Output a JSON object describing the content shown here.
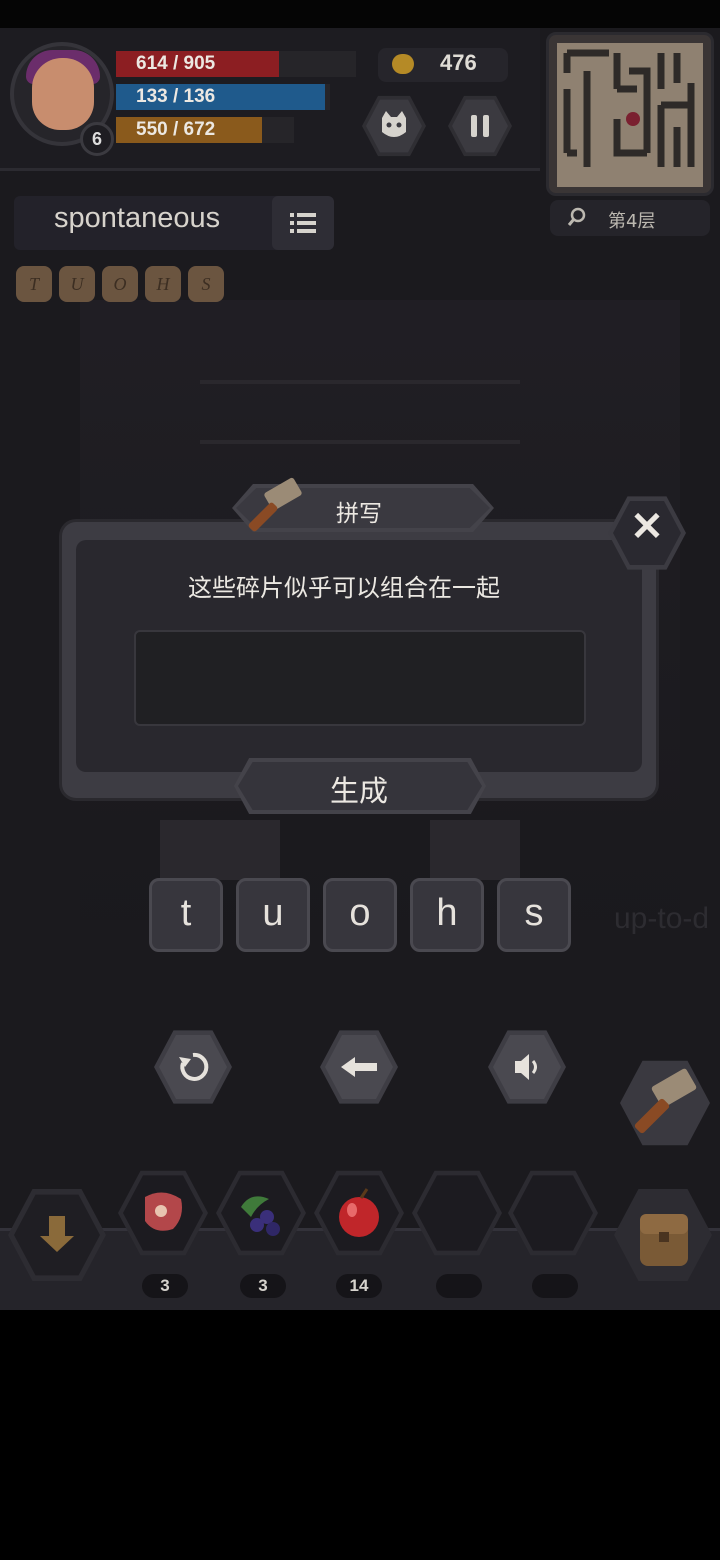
{
  "player": {
    "level": "6",
    "hp_text": "614 / 905",
    "hp_fraction": 0.678,
    "mp_text": "133 / 136",
    "mp_fraction": 0.978,
    "xp_text": "550 / 672",
    "xp_fraction": 0.818,
    "hp_color": "#8c1e22",
    "mp_color": "#1f5a8c",
    "xp_color": "#8a5a1c"
  },
  "gold": "476",
  "floor": "第4层",
  "current_word": "spontaneous",
  "fragments": [
    "T",
    "U",
    "O",
    "H",
    "S"
  ],
  "dialog": {
    "title": "拼写",
    "message": "这些碎片似乎可以组合在一起",
    "input_value": "",
    "generate_label": "生成"
  },
  "letter_tiles": [
    "t",
    "u",
    "o",
    "h",
    "s"
  ],
  "background_hint": "up-to-d",
  "items": [
    {
      "icon": "meat-icon",
      "count": "3"
    },
    {
      "icon": "berries-icon",
      "count": "3"
    },
    {
      "icon": "apple-icon",
      "count": "14"
    },
    {
      "icon": "empty-slot",
      "count": ""
    },
    {
      "icon": "empty-slot",
      "count": ""
    }
  ],
  "icons": {
    "pet": "cat-face-icon",
    "pause": "pause-icon",
    "search": "search-icon",
    "list": "list-icon",
    "hammer": "hammer-icon",
    "close": "close-icon",
    "reset": "rotate-icon",
    "backspace": "arrow-left-icon",
    "sound": "speaker-icon",
    "descend": "arrow-down-icon",
    "bag": "backpack-icon"
  }
}
